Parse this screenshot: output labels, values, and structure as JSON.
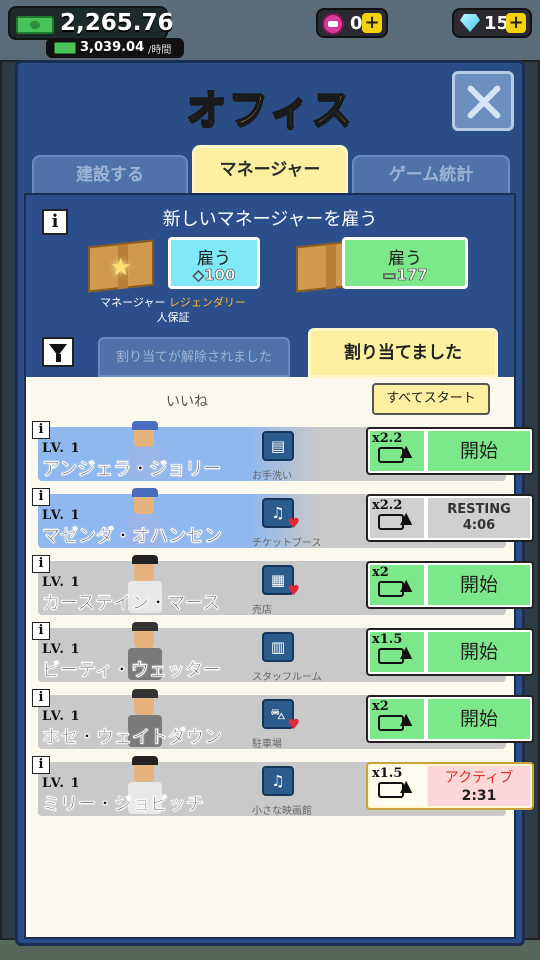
{
  "top_bar": {
    "cash": "2,265.76",
    "income_rate": "3,039.04",
    "income_unit": "/時間",
    "tickets": "0",
    "gems": "15"
  },
  "panel": {
    "title": "オフィス",
    "tabs": [
      "建設する",
      "マネージャー",
      "ゲーム統計"
    ],
    "active_tab": "マネージャー"
  },
  "hire": {
    "title": "新しいマネージャーを雇う",
    "gem_option": {
      "label": "雇う",
      "price": "100"
    },
    "cash_option": {
      "label": "雇う",
      "price": "177"
    },
    "guarantee_prefix": "マネージャー ",
    "guarantee_highlight": "レジェンダリー",
    "guarantee_suffix": " 人保証"
  },
  "subtabs": {
    "unassigned": "割り当てが解除されました",
    "assigned": "割り当てました"
  },
  "list_header": {
    "likes": "いいね",
    "start_all": "すべてスタート"
  },
  "managers": [
    {
      "level": "LV. 1",
      "name": "アンジェラ・ジョリー",
      "facility": "お手洗い",
      "facility_icon": "film-icon",
      "multiplier": "x2.2",
      "action": "開始",
      "state": "ready",
      "liked": false
    },
    {
      "level": "LV. 1",
      "name": "マゼンダ・オハンセン",
      "facility": "チケットブース",
      "facility_icon": "headset-icon",
      "multiplier": "x2.2",
      "action": "RESTING",
      "timer": "4:06",
      "state": "resting",
      "liked": true
    },
    {
      "level": "LV. 1",
      "name": "カーステイン・マース",
      "facility": "売店",
      "facility_icon": "register-icon",
      "multiplier": "x2",
      "action": "開始",
      "state": "ready",
      "liked": true
    },
    {
      "level": "LV. 1",
      "name": "ビーティ・ウェッター",
      "facility": "スタッフルーム",
      "facility_icon": "locker-icon",
      "multiplier": "x1.5",
      "action": "開始",
      "state": "ready",
      "liked": false
    },
    {
      "level": "LV. 1",
      "name": "ホセ・ウェイトダウン",
      "facility": "駐車場",
      "facility_icon": "car-icon",
      "multiplier": "x2",
      "action": "開始",
      "state": "ready",
      "liked": true
    },
    {
      "level": "LV. 1",
      "name": "ミリー・ジョビッチ",
      "facility": "小さな映画館",
      "facility_icon": "headset-icon",
      "multiplier": "x1.5",
      "action": "アクティブ",
      "timer": "2:31",
      "state": "active",
      "liked": false
    }
  ]
}
